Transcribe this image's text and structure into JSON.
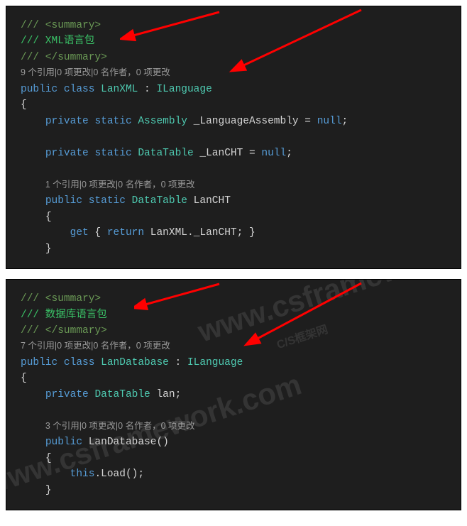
{
  "block1": {
    "doc_open": "/// <summary>",
    "doc_body": "/// XML语言包",
    "doc_close": "/// </summary>",
    "codelens1": "9 个引用|0 项更改|0 名作者，0 项更改",
    "kw_public": "public",
    "kw_class": "class",
    "class_name": "LanXML",
    "colon": " : ",
    "iface": "ILanguage",
    "brace_open": "{",
    "kw_private": "private",
    "kw_static": "static",
    "type_assembly": "Assembly",
    "field1_name": " _LanguageAssembly = ",
    "kw_null": "null",
    "semi": ";",
    "type_datatable": "DataTable",
    "field2_name": " _LanCHT = ",
    "codelens2": "1 个引用|0 项更改|0 名作者，0 项更改",
    "prop_name": " LanCHT",
    "prop_brace_open": "{",
    "kw_get": "get",
    "get_body_open": " { ",
    "kw_return": "return",
    "ret_expr1": " LanXML.",
    "ret_expr2": "_LanCHT; }",
    "prop_brace_close": "}"
  },
  "block2": {
    "doc_open": "/// <summary>",
    "doc_body": "/// 数据库语言包",
    "doc_close": "/// </summary>",
    "codelens1": "7 个引用|0 项更改|0 名作者，0 项更改",
    "kw_public": "public",
    "kw_class": "class",
    "class_name": "LanDatabase",
    "colon": " : ",
    "iface": "ILanguage",
    "brace_open": "{",
    "kw_private": "private",
    "type_datatable": "DataTable",
    "field1_name": " lan;",
    "codelens2": "3 个引用|0 项更改|0 名作者，0 项更改",
    "ctor_name": " LanDatabase()",
    "ctor_brace_open": "{",
    "kw_this": "this",
    "ctor_body": ".Load();",
    "ctor_brace_close": "}"
  },
  "watermark": {
    "url": "www.csframework.com",
    "label": "C/S框架网"
  }
}
